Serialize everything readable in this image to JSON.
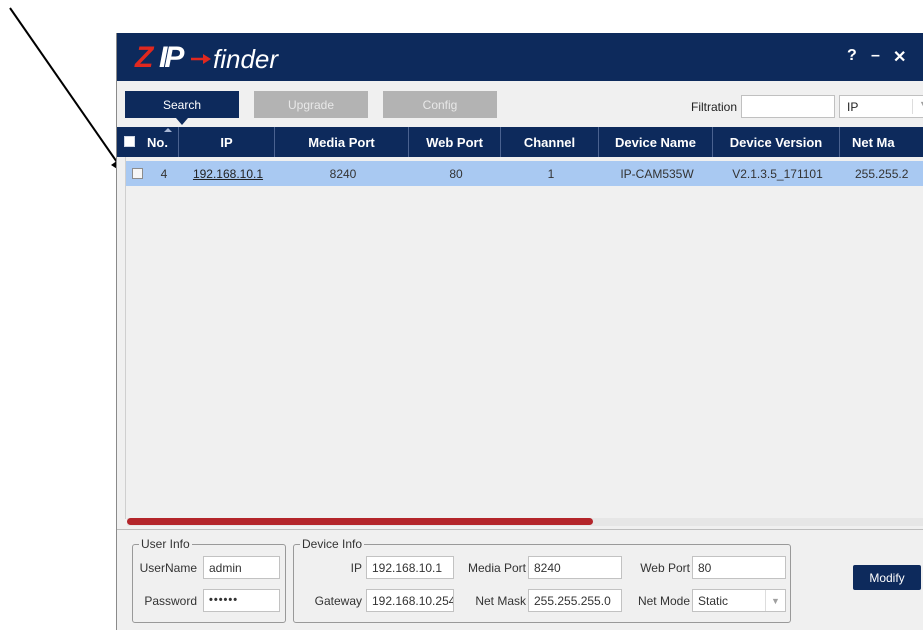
{
  "window": {
    "logo": {
      "z": "Z",
      "ip": "IP",
      "name": "finder"
    },
    "controls": {
      "help": "?",
      "minimize": "–",
      "close": "✕"
    }
  },
  "toolbar": {
    "search_label": "Search",
    "upgrade_label": "Upgrade",
    "config_label": "Config",
    "filtration_label": "Filtration",
    "filtration_value": "",
    "filter_type": "IP",
    "filter_dropdown_icon": "chevron-down-icon"
  },
  "table": {
    "columns": [
      "No.",
      "IP",
      "Media Port",
      "Web Port",
      "Channel",
      "Device Name",
      "Device Version",
      "Net Ma"
    ],
    "rows": [
      {
        "no": "4",
        "ip": "192.168.10.1",
        "media_port": "8240",
        "web_port": "80",
        "channel": "1",
        "device_name": "IP-CAM535W",
        "device_version": "V2.1.3.5_171101",
        "net_mask": "255.255.2"
      }
    ]
  },
  "user_info": {
    "title": "User Info",
    "username_label": "UserName",
    "username_value": "admin",
    "password_label": "Password",
    "password_value": "••••••"
  },
  "device_info": {
    "title": "Device Info",
    "ip_label": "IP",
    "ip_value": "192.168.10.1",
    "media_port_label": "Media Port",
    "media_port_value": "8240",
    "web_port_label": "Web Port",
    "web_port_value": "80",
    "gateway_label": "Gateway",
    "gateway_value": "192.168.10.254",
    "net_mask_label": "Net Mask",
    "net_mask_value": "255.255.255.0",
    "net_mode_label": "Net Mode",
    "net_mode_value": "Static"
  },
  "modify_label": "Modify",
  "colors": {
    "title_bar": "#0d2a5c",
    "logo_red": "#e0281f",
    "selected_row": "#a9c9f2",
    "scroll_thumb": "#b3252a"
  }
}
